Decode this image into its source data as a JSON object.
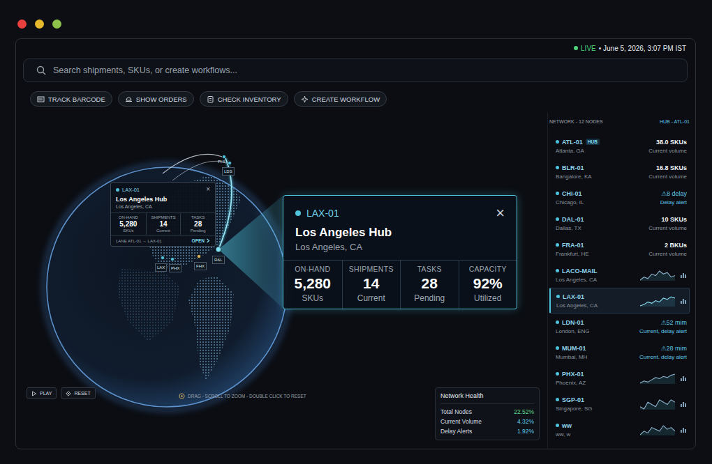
{
  "window": {
    "controls": [
      {
        "name": "close",
        "color": "#e8403f"
      },
      {
        "name": "minimize",
        "color": "#e5b92b"
      },
      {
        "name": "zoom",
        "color": "#8dc34a"
      }
    ]
  },
  "status": {
    "live": "LIVE",
    "timestamp": "• June 5, 2026, 3:07 PM IST"
  },
  "search": {
    "placeholder": "Search shipments, SKUs, or create workflows..."
  },
  "actions": [
    {
      "label": "TRACK BARCODE",
      "kind": "barcode"
    },
    {
      "label": "SHOW ORDERS",
      "kind": "orders"
    },
    {
      "label": "CHECK INVENTORY",
      "kind": "inventory"
    },
    {
      "label": "CREATE WORKFLOW",
      "kind": "workflow"
    }
  ],
  "globe": {
    "pins": [
      {
        "label": "PHI",
        "color": "#4fc3dc"
      },
      {
        "label": "LDS",
        "color": "#4fc3dc"
      },
      {
        "label": "LAX",
        "color": "#4fc3dc"
      },
      {
        "label": "PHX",
        "color": "#4fc3dc"
      },
      {
        "label": "FHX",
        "color": "#d8b45a"
      },
      {
        "label": "R&L",
        "color": "#7fe3f5"
      }
    ]
  },
  "mini_card": {
    "code": "LAX-01",
    "close": "×",
    "title": "Los Angeles Hub",
    "subtitle": "Los Angeles, CA",
    "stats": [
      {
        "label": "ON-HAND",
        "value": "5,280",
        "unit": "SKUs"
      },
      {
        "label": "SHIPMENTS",
        "value": "14",
        "unit": "Current"
      },
      {
        "label": "TASKS",
        "value": "28",
        "unit": "Pending"
      }
    ],
    "lane_label": "LANE",
    "lane": "ATL-01 → LAX-01",
    "action": "OPEN"
  },
  "detail_card": {
    "code": "LAX-01",
    "close": "×",
    "title": "Los Angeles Hub",
    "subtitle": "Los Angeles, CA",
    "stats": [
      {
        "label": "ON-HAND",
        "value": "5,280",
        "unit": "SKUs"
      },
      {
        "label": "SHIPMENTS",
        "value": "14",
        "unit": "Current"
      },
      {
        "label": "TASKS",
        "value": "28",
        "unit": "Pending"
      },
      {
        "label": "CAPACITY",
        "value": "92%",
        "unit": "Utilized"
      }
    ]
  },
  "playback": [
    {
      "label": "PLAY",
      "kind": "play"
    },
    {
      "label": "RESET",
      "kind": "reset"
    }
  ],
  "hint": "DRAG - SCROLL TO ZOOM - DOUBLE CLICK TO RESET",
  "network_health": {
    "title": "Network Health",
    "rows": [
      {
        "label": "Total Nodes",
        "value": "22.52%",
        "color": "#5fd68a"
      },
      {
        "label": "Current Volume",
        "value": "4.32%",
        "color": "#5fc8e8"
      },
      {
        "label": "Delay Alerts",
        "value": "1.92%",
        "color": "#5fc8e8"
      }
    ]
  },
  "sidebar": {
    "title": "NETWORK - 12 NODES",
    "hub": "HUB - ATL-01",
    "nodes": [
      {
        "code": "ATL-01",
        "badge": "HUB",
        "location": "Atlanta, GA",
        "kind": "volume",
        "value": "38.0 SKUs",
        "caption": "Current volume",
        "selected": false
      },
      {
        "code": "BLR-01",
        "badge": "",
        "location": "Bangalore, KA",
        "kind": "volume",
        "value": "16.8 SKUs",
        "caption": "Current volume",
        "selected": false
      },
      {
        "code": "CHI-01",
        "badge": "",
        "location": "Chicago, IL",
        "kind": "alert",
        "icon": "⚠",
        "value": "8 delay",
        "caption": "Delay alert",
        "selected": false
      },
      {
        "code": "DAL-01",
        "badge": "",
        "location": "Dallas, TX",
        "kind": "volume",
        "value": "10 SKUs",
        "caption": "Current volume",
        "selected": false
      },
      {
        "code": "FRA-01",
        "badge": "",
        "location": "Frankfurt, HE",
        "kind": "volume",
        "value": "2 BKUs",
        "caption": "Current volume",
        "selected": false
      },
      {
        "code": "LACO-MAIL",
        "badge": "",
        "location": "Los Angeles, CA",
        "kind": "chart",
        "series": [
          5,
          7,
          6,
          9,
          8,
          11,
          9,
          10,
          7,
          8
        ],
        "selected": false
      },
      {
        "code": "LAX-01",
        "badge": "",
        "location": "Los Angeles, CA",
        "kind": "chart",
        "series": [
          4,
          5,
          7,
          6,
          8,
          7,
          10,
          9,
          11,
          10
        ],
        "selected": true
      },
      {
        "code": "LDN-01",
        "badge": "",
        "location": "London, ENG",
        "kind": "alert",
        "icon": "⚠",
        "value": "52 mim",
        "caption": "Current, delay alert",
        "selected": false
      },
      {
        "code": "MUM-01",
        "badge": "",
        "location": "Mumbai, MH",
        "kind": "alert",
        "icon": "⚠",
        "value": "28 mim",
        "caption": "Current. delay alert",
        "selected": false
      },
      {
        "code": "PHX-01",
        "badge": "",
        "location": "Phoenix, AZ",
        "kind": "chart",
        "series": [
          3,
          5,
          4,
          6,
          8,
          7,
          9,
          8,
          10,
          11
        ],
        "selected": false
      },
      {
        "code": "SGP-01",
        "badge": "",
        "location": "Singapore, SG",
        "kind": "chart",
        "series": [
          6,
          5,
          8,
          7,
          6,
          9,
          8,
          7,
          9,
          8
        ],
        "selected": false
      },
      {
        "code": "ww",
        "badge": "",
        "location": "ww, w",
        "kind": "chart",
        "series": [
          4,
          6,
          5,
          8,
          7,
          6,
          9,
          7,
          8,
          6
        ],
        "selected": false
      }
    ]
  }
}
